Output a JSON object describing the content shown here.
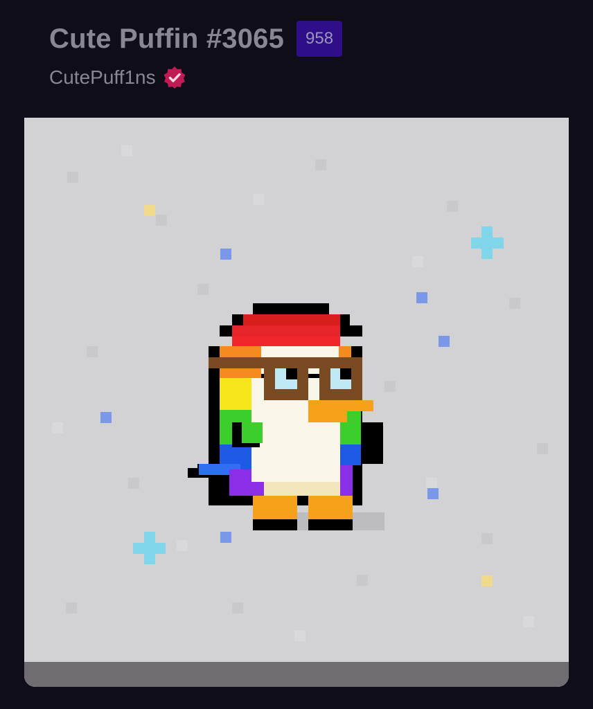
{
  "nft": {
    "title": "Cute Puffin #3065",
    "rank": "958",
    "creator": "CutePuff1ns"
  },
  "colors": {
    "background": "#0f0d17",
    "badge_bg": "#2f0e8a",
    "verified": "#c01b55",
    "art_bg": "#d2d2d4"
  },
  "icons": {
    "verified": "check-badge"
  }
}
